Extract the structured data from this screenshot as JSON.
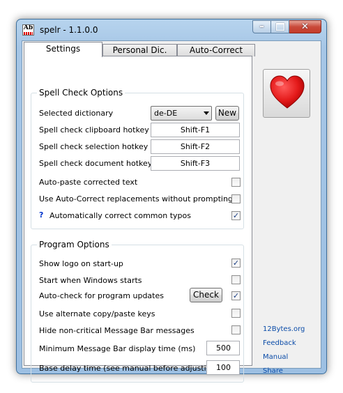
{
  "window": {
    "title": "spelr - 1.1.0.0",
    "icon_text": "Ab"
  },
  "tabs": [
    {
      "label": "Settings",
      "active": true
    },
    {
      "label": "Personal Dic.",
      "active": false
    },
    {
      "label": "Auto-Correct",
      "active": false
    }
  ],
  "spell_check": {
    "group_title": "Spell Check Options",
    "selected_dictionary_label": "Selected dictionary",
    "dictionary_value": "de-DE",
    "new_button": "New",
    "clipboard_hotkey_label": "Spell check clipboard hotkey",
    "clipboard_hotkey": "Shift-F1",
    "selection_hotkey_label": "Spell check selection hotkey",
    "selection_hotkey": "Shift-F2",
    "document_hotkey_label": "Spell check document hotkey",
    "document_hotkey": "Shift-F3",
    "auto_paste_label": "Auto-paste corrected text",
    "auto_paste": false,
    "auto_correct_no_prompt_label": "Use Auto-Correct replacements without prompting",
    "auto_correct_no_prompt": false,
    "help_mark": "?",
    "auto_correct_typos_label": "Automatically correct common typos",
    "auto_correct_typos": true
  },
  "program": {
    "group_title": "Program Options",
    "show_logo_label": "Show logo on start-up",
    "show_logo": true,
    "start_with_windows_label": "Start when Windows starts",
    "start_with_windows": false,
    "auto_check_updates_label": "Auto-check for program updates",
    "check_button": "Check",
    "auto_check_updates": true,
    "alt_copy_paste_label": "Use alternate copy/paste keys",
    "alt_copy_paste": false,
    "hide_noncritical_label": "Hide non-critical Message Bar messages",
    "hide_noncritical": false,
    "min_display_time_label": "Minimum Message Bar display time (ms)",
    "min_display_time": "500",
    "base_delay_label": "Base delay time (see manual before adjusting)",
    "base_delay": "100"
  },
  "links": [
    "12Bytes.org",
    "Feedback",
    "Manual",
    "Share"
  ],
  "colors": {
    "heart": "#e41a1a",
    "link": "#0b4ca8",
    "check": "#1b3e83"
  }
}
